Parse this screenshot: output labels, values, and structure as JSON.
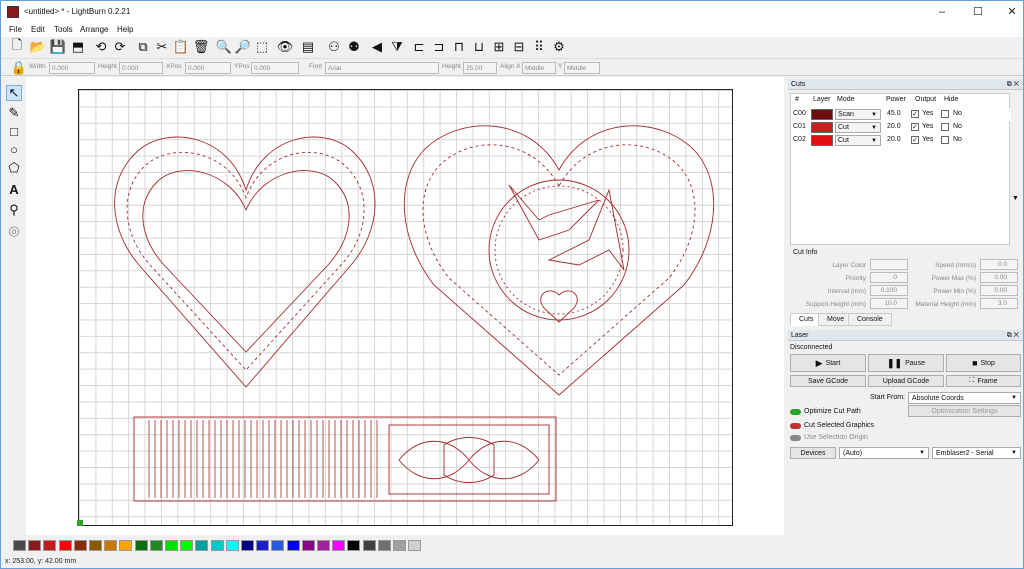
{
  "window": {
    "title": "<untitled> * - LightBurn 0.2.21",
    "minimize": "–",
    "maximize": "☐",
    "close": "✕"
  },
  "menu": [
    "File",
    "Edit",
    "Tools",
    "Arrange",
    "Help"
  ],
  "toolbar2": {
    "width_label": "Width",
    "width_value": "0.000",
    "height_label": "Height",
    "height_value": "0.000",
    "xpos_label": "XPos",
    "xpos_value": "0.000",
    "ypos_label": "YPos",
    "ypos_value": "0.000",
    "font_label": "Font",
    "font_value": "Arial",
    "fheight_label": "Height",
    "fheight_value": "25.00",
    "alignx_label": "Align X",
    "alignx_value": "Middle",
    "aligny_label": "Y",
    "aligny_value": "Middle"
  },
  "colors": {
    "c00": "#6e0f0f",
    "c01": "#c91e1e",
    "c02": "#e01010",
    "accent": "#2aa32a",
    "shape": "#a52a2a"
  },
  "cuts": {
    "title": "Cuts",
    "headers": [
      "#",
      "Layer",
      "Mode",
      "Power",
      "Output",
      "Hide"
    ],
    "rows": [
      {
        "id": "C00",
        "mode": "Scan",
        "power": "45.0",
        "output": "Yes",
        "hide": "No"
      },
      {
        "id": "C01",
        "mode": "Cut",
        "power": "20.0",
        "output": "Yes",
        "hide": "No"
      },
      {
        "id": "C02",
        "mode": "Cut",
        "power": "20.0",
        "output": "Yes",
        "hide": "No"
      }
    ]
  },
  "cutinfo": {
    "title": "Cut Info",
    "layer_color": "Layer Color",
    "priority": "Priority",
    "priority_val": "0",
    "interval": "Interval (mm)",
    "interval_val": "0.100",
    "support_height": "Support Height (mm)",
    "support_val": "10.0",
    "speed": "Speed (mm/s)",
    "speed_val": "0.0",
    "power_max": "Power Max (%)",
    "power_max_val": "0.00",
    "power_min": "Power Min (%)",
    "power_min_val": "0.00",
    "material_height": "Material Height (mm)",
    "material_val": "3.0"
  },
  "tabs": [
    "Cuts",
    "Move",
    "Console"
  ],
  "laser": {
    "title": "Laser",
    "status": "Disconnected",
    "start": "Start",
    "pause": "Pause",
    "stop": "Stop",
    "save_gcode": "Save GCode",
    "upload_gcode": "Upload GCode",
    "frame": "Frame",
    "start_from_label": "Start From:",
    "start_from_value": "Absolute Coords",
    "optimize_cut_path": "Optimize Cut Path",
    "optimization_settings": "Optimization Settings",
    "cut_selected_graphics": "Cut Selected Graphics",
    "use_selection_origin": "Use Selection Origin",
    "devices": "Devices",
    "port": "(Auto)",
    "device": "Emblaser2 - Serial"
  },
  "palette": [
    "#4a4a4a",
    "#8b1a1a",
    "#c31a1a",
    "#ff0000",
    "#8b2b00",
    "#8b5a00",
    "#c87800",
    "#ffa500",
    "#0a6e0a",
    "#1e8b1e",
    "#00e000",
    "#00ff00",
    "#00a0a0",
    "#00c8c8",
    "#00ffff",
    "#000080",
    "#1e1ec8",
    "#2a5adc",
    "#0000ff",
    "#8b008b",
    "#a020a0",
    "#ff00ff",
    "#000000",
    "#404040",
    "#707070",
    "#a0a0a0",
    "#d0d0d0"
  ],
  "status": {
    "coords": "x: 253.00, y: 42.00 mm"
  }
}
